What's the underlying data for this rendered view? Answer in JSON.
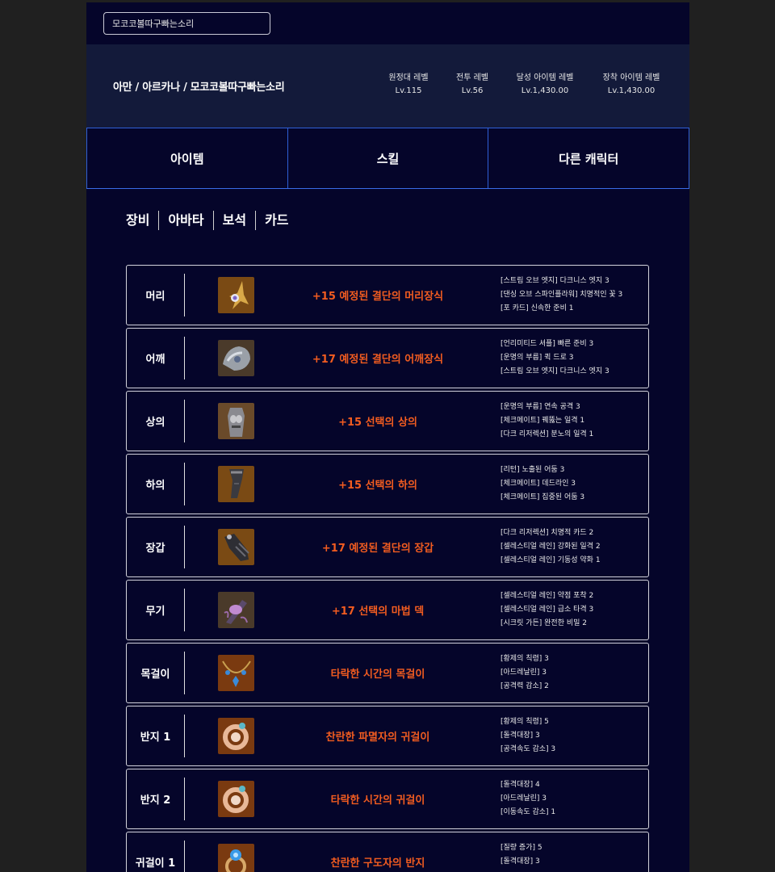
{
  "search": {
    "value": "모코코볼따구빠는소리"
  },
  "character": {
    "name_line": "아만 / 아르카나 / 모코코볼따구빠는소리",
    "stats": [
      {
        "label": "원정대 레벨",
        "value": "Lv.115"
      },
      {
        "label": "전투 레벨",
        "value": "Lv.56"
      },
      {
        "label": "달성 아이템 레벨",
        "value": "Lv.1,430.00"
      },
      {
        "label": "장착 아이템 레벨",
        "value": "Lv.1,430.00"
      }
    ]
  },
  "tabs": [
    "아이템",
    "스킬",
    "다른 캐릭터"
  ],
  "subnav": [
    "장비",
    "아바타",
    "보석",
    "카드"
  ],
  "colors": {
    "accent_item_name": "#f25c20",
    "page_bg": "#05052a",
    "header_bg": "#131a3a",
    "tab_border": "#2f5fd6"
  },
  "equipment": [
    {
      "slot": "머리",
      "icon": "headpiece-icon",
      "name": "+15 예정된 결단의 머리장식",
      "effects": [
        "[스트림 오브 엣지] 다크니스 엣지 3",
        "[댄싱 오브 스파인플라워] 치명적인 꽃 3",
        "[포 카드] 신속한 준비 1"
      ]
    },
    {
      "slot": "어깨",
      "icon": "shoulder-icon",
      "name": "+17 예정된 결단의 어깨장식",
      "effects": [
        "[언리미티드 셔플] 빠른 준비 3",
        "[운명의 부름] 퀵 드로 3",
        "[스트림 오브 엣지] 다크니스 엣지 3"
      ]
    },
    {
      "slot": "상의",
      "icon": "chest-armor-icon",
      "name": "+15 선택의 상의",
      "effects": [
        "[운명의 부름] 연속 공격 3",
        "[체크메이트] 꿰뚫는 일격 1",
        "[다크 리저렉션] 분노의 일격 1"
      ]
    },
    {
      "slot": "하의",
      "icon": "pants-icon",
      "name": "+15 선택의 하의",
      "effects": [
        "[리턴] 노출된 어둠 3",
        "[체크메이트] 데드라인 3",
        "[체크메이트] 집중된 어둠 3"
      ]
    },
    {
      "slot": "장갑",
      "icon": "gloves-icon",
      "name": "+17 예정된 결단의 장갑",
      "effects": [
        "[다크 리저렉션] 치명적 카드 2",
        "[셀레스티얼 레인] 강화된 일격 2",
        "[셀레스티얼 레인] 기동성 약화 1"
      ]
    },
    {
      "slot": "무기",
      "icon": "magic-deck-icon",
      "name": "+17 선택의 마법 덱",
      "effects": [
        "[셀레스티얼 레인] 약점 포착 2",
        "[셀레스티얼 레인] 급소 타격 3",
        "[시크릿 가든] 완전한 비밀 2"
      ]
    },
    {
      "slot": "목걸이",
      "icon": "necklace-icon",
      "name": "타락한 시간의 목걸이",
      "effects": [
        "[황제의 칙령] 3",
        "[아드레날린] 3",
        "[공격력 감소] 2"
      ]
    },
    {
      "slot": "반지 1",
      "icon": "earring-icon",
      "name": "찬란한 파멸자의 귀걸이",
      "effects": [
        "[황제의 칙령] 5",
        "[돌격대장] 3",
        "[공격속도 감소] 3"
      ]
    },
    {
      "slot": "반지 2",
      "icon": "earring-icon",
      "name": "타락한 시간의 귀걸이",
      "effects": [
        "[돌격대장] 4",
        "[아드레날린] 3",
        "[이동속도 감소] 1"
      ]
    },
    {
      "slot": "귀걸이 1",
      "icon": "ring-icon",
      "name": "찬란한 구도자의 반지",
      "effects": [
        "[질량 증가] 5",
        "[돌격대장] 3",
        ""
      ]
    }
  ]
}
